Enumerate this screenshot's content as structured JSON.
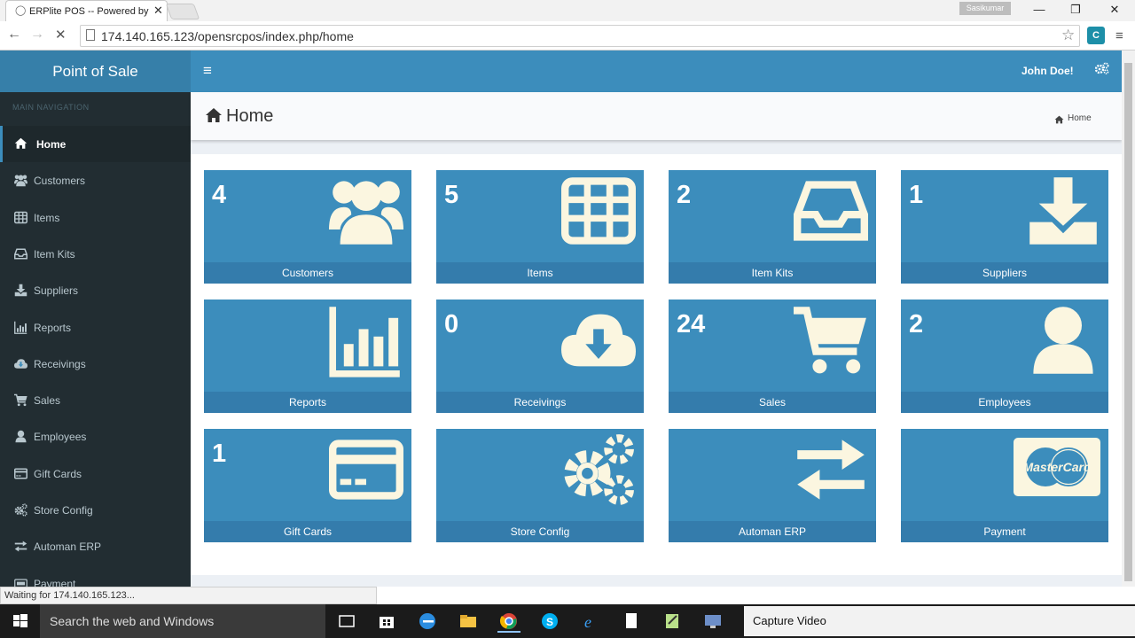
{
  "browser": {
    "tab_title": "ERPlite POS -- Powered by",
    "url": "174.140.165.123/opensrcpos/index.php/home",
    "profile_name": "Sasikumar",
    "status_text": "Waiting for 174.140.165.123...",
    "tab_close": "✕",
    "back": "←",
    "forward": "→",
    "stop": "✕",
    "star": "☆",
    "minimize": "—",
    "restore": "❐",
    "close": "✕",
    "menu": "≡",
    "ext_label": "C"
  },
  "app": {
    "logo_text": "Point of Sale",
    "user_name": "John Doe!",
    "nav_header": "MAIN NAVIGATION",
    "page_title": "Home",
    "breadcrumb": "Home",
    "toggle": "≡"
  },
  "sidebar": {
    "items": [
      {
        "label": "Home",
        "icon": "home-icon",
        "active": true
      },
      {
        "label": "Customers",
        "icon": "users-icon"
      },
      {
        "label": "Items",
        "icon": "table-icon"
      },
      {
        "label": "Item Kits",
        "icon": "inbox-icon"
      },
      {
        "label": "Suppliers",
        "icon": "download-icon"
      },
      {
        "label": "Reports",
        "icon": "bar-chart-icon"
      },
      {
        "label": "Receivings",
        "icon": "cloud-download-icon"
      },
      {
        "label": "Sales",
        "icon": "cart-icon"
      },
      {
        "label": "Employees",
        "icon": "user-icon"
      },
      {
        "label": "Gift Cards",
        "icon": "credit-card-icon"
      },
      {
        "label": "Store Config",
        "icon": "cogs-icon"
      },
      {
        "label": "Automan ERP",
        "icon": "exchange-icon"
      },
      {
        "label": "Payment",
        "icon": "cc-mastercard-icon"
      }
    ]
  },
  "tiles": [
    {
      "label": "Customers",
      "count": "4",
      "icon": "users-icon"
    },
    {
      "label": "Items",
      "count": "5",
      "icon": "table-icon"
    },
    {
      "label": "Item Kits",
      "count": "2",
      "icon": "inbox-icon"
    },
    {
      "label": "Suppliers",
      "count": "1",
      "icon": "download-icon"
    },
    {
      "label": "Reports",
      "count": "",
      "icon": "bar-chart-icon"
    },
    {
      "label": "Receivings",
      "count": "0",
      "icon": "cloud-download-icon"
    },
    {
      "label": "Sales",
      "count": "24",
      "icon": "cart-icon"
    },
    {
      "label": "Employees",
      "count": "2",
      "icon": "user-icon"
    },
    {
      "label": "Gift Cards",
      "count": "1",
      "icon": "credit-card-icon"
    },
    {
      "label": "Store Config",
      "count": "",
      "icon": "cogs-icon"
    },
    {
      "label": "Automan ERP",
      "count": "",
      "icon": "exchange-icon"
    },
    {
      "label": "Payment",
      "count": "",
      "icon": "mastercard-icon",
      "icon_text": "MasterCard"
    }
  ],
  "taskbar": {
    "search_placeholder": "Search the web and Windows",
    "capture_label": "Capture Video"
  },
  "colors": {
    "primary": "#3c8dbc",
    "logo_bg": "#367fa9",
    "sidebar_bg": "#222d32",
    "tile_footer": "#347cac",
    "icon_fill": "#fbf6e0"
  }
}
